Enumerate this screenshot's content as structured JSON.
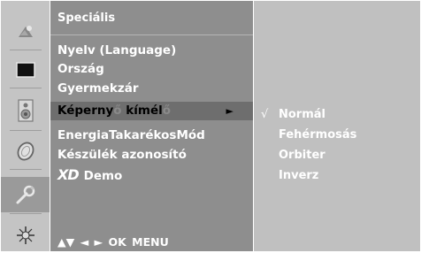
{
  "sidebar": {
    "icons": [
      {
        "name": "picture-icon",
        "active": false
      },
      {
        "name": "screen-icon",
        "active": false
      },
      {
        "name": "speaker-icon",
        "active": false
      },
      {
        "name": "clock-icon",
        "active": false
      },
      {
        "name": "wrench-icon",
        "active": true
      },
      {
        "name": "settings-icon",
        "active": false
      }
    ]
  },
  "menu": {
    "title": "Speciális",
    "items": [
      {
        "label": "Nyelv (Language)"
      },
      {
        "label": "Ország"
      },
      {
        "label": "Gyermekzár"
      },
      {
        "label_dark": "Képerny",
        "label_faded": "ő ",
        "label_dark2": "kímél",
        "label_faded2": "ő",
        "arrow": "►"
      },
      {
        "label": "EnergiaTakarékosMód"
      },
      {
        "label": "Készülék azonosító"
      },
      {
        "logo": "XD",
        "label": "Demo"
      }
    ],
    "nav_hint": "▲▼  ◄ ►  OK  MENU"
  },
  "submenu": {
    "items": [
      {
        "check": "√",
        "label": "Normál"
      },
      {
        "check": "",
        "label": "Fehérmosás"
      },
      {
        "check": "",
        "label": "Orbiter"
      },
      {
        "check": "",
        "label": "Inverz"
      }
    ]
  },
  "colors": {
    "sidebar_bg": "#c4c4c4",
    "menu_bg": "#8e8e8e",
    "selected_bg": "#6e6e6e",
    "submenu_bg": "#c0c0c0",
    "text": "#ffffff"
  }
}
